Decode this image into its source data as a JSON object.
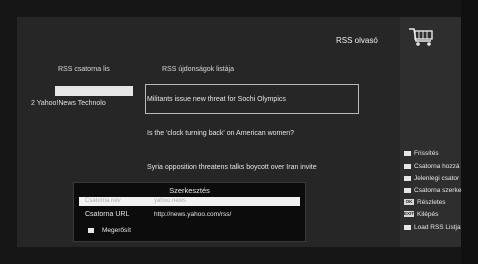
{
  "header": {
    "title": "RSS olvasó"
  },
  "channels": {
    "header": "RSS csatorna lis",
    "items": [
      "2  Yahoo!News Technolo"
    ]
  },
  "news": {
    "header": "RSS újdonságok listája",
    "items": [
      "Militants issue new threat for Sochi Olympics",
      "Is the 'clock turning back' on American women?",
      "Syria opposition threatens talks boycott over Iran invite"
    ]
  },
  "menu": {
    "items": [
      {
        "icon": "square-icon",
        "tag": "",
        "label": "Frissítés"
      },
      {
        "icon": "square-icon",
        "tag": "",
        "label": "Csatorna hozzá"
      },
      {
        "icon": "square-icon",
        "tag": "",
        "label": "Jelenlegi csator"
      },
      {
        "icon": "square-icon",
        "tag": "",
        "label": "Csatorna szerke"
      },
      {
        "icon": "ok-key-icon",
        "tag": "OK",
        "label": "Részletes"
      },
      {
        "icon": "exit-key-icon",
        "tag": "EXIT",
        "label": "Kilépés"
      },
      {
        "icon": "square-icon",
        "tag": "",
        "label": "Load RSS Listja"
      }
    ]
  },
  "dialog": {
    "title": "Szerkesztés",
    "row_name_label": "Csatorna név",
    "row_name_value": "yahoo news",
    "url_label": "Csatorna URL",
    "url_value": "http://news.yahoo.com/rss/",
    "confirm_label": "Megerősít"
  }
}
